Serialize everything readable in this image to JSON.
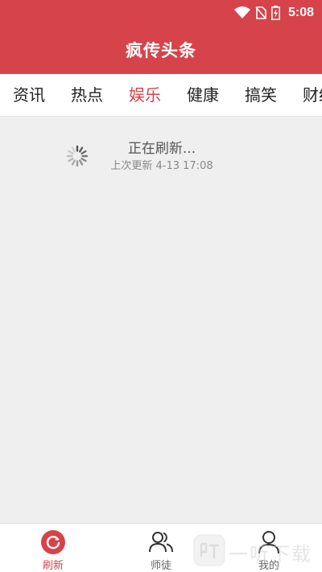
{
  "status_bar": {
    "time": "5:08"
  },
  "app": {
    "title": "疯传头条"
  },
  "tabs": [
    {
      "label": "资讯",
      "active": false
    },
    {
      "label": "热点",
      "active": false
    },
    {
      "label": "娱乐",
      "active": true
    },
    {
      "label": "健康",
      "active": false
    },
    {
      "label": "搞笑",
      "active": false
    },
    {
      "label": "财经",
      "active": false
    }
  ],
  "refresh": {
    "status": "正在刷新...",
    "last_updated": "上次更新 4-13 17:08"
  },
  "bottom_nav": [
    {
      "label": "刷新",
      "icon": "refresh-icon",
      "active": true
    },
    {
      "label": "师徒",
      "icon": "users-icon",
      "active": false
    },
    {
      "label": "我的",
      "icon": "user-icon",
      "active": false
    }
  ],
  "watermark": {
    "text": "一听下载"
  },
  "colors": {
    "brand": "#d6434a",
    "background": "#efefef",
    "text": "#222222",
    "muted": "#888888"
  }
}
